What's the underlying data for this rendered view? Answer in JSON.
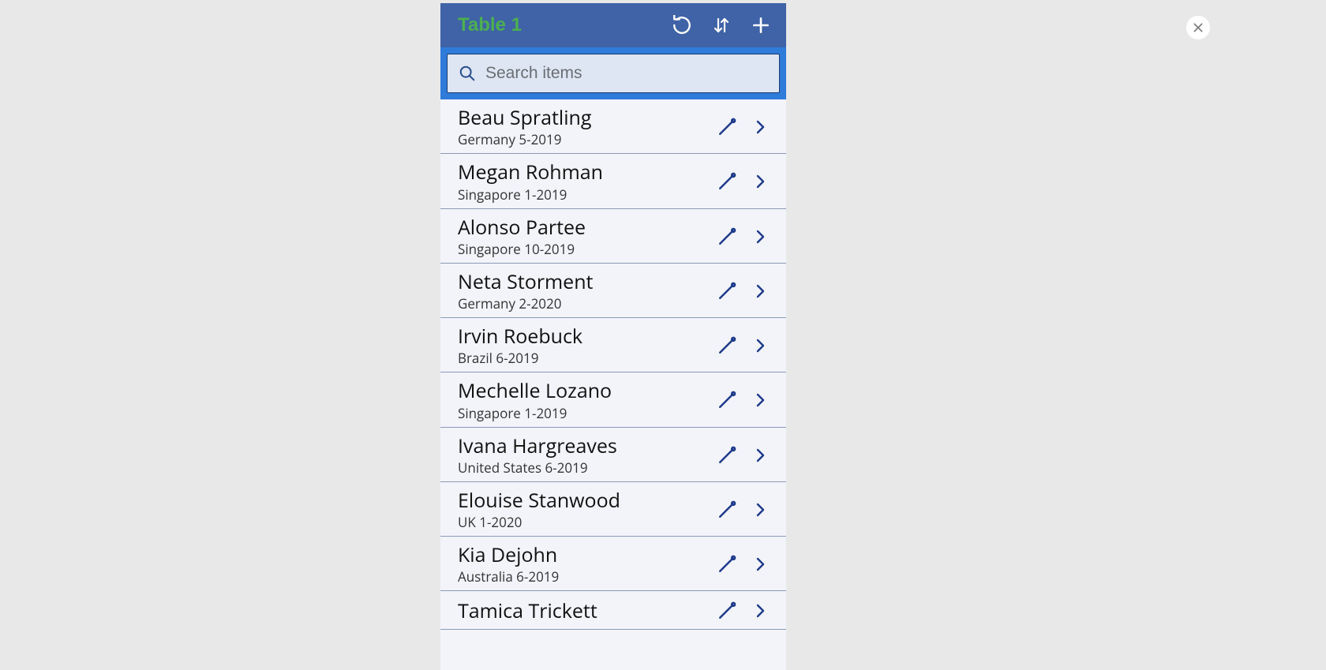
{
  "header": {
    "title": "Table 1"
  },
  "search": {
    "placeholder": "Search items",
    "value": ""
  },
  "rows": [
    {
      "name": "Beau Spratling",
      "sub": "Germany 5-2019"
    },
    {
      "name": "Megan Rohman",
      "sub": "Singapore 1-2019"
    },
    {
      "name": "Alonso Partee",
      "sub": "Singapore 10-2019"
    },
    {
      "name": "Neta Storment",
      "sub": "Germany 2-2020"
    },
    {
      "name": "Irvin Roebuck",
      "sub": "Brazil 6-2019"
    },
    {
      "name": "Mechelle Lozano",
      "sub": "Singapore 1-2019"
    },
    {
      "name": "Ivana Hargreaves",
      "sub": "United States 6-2019"
    },
    {
      "name": "Elouise Stanwood",
      "sub": "UK 1-2020"
    },
    {
      "name": "Kia Dejohn",
      "sub": "Australia 6-2019"
    },
    {
      "name": "Tamica Trickett",
      "sub": ""
    }
  ]
}
